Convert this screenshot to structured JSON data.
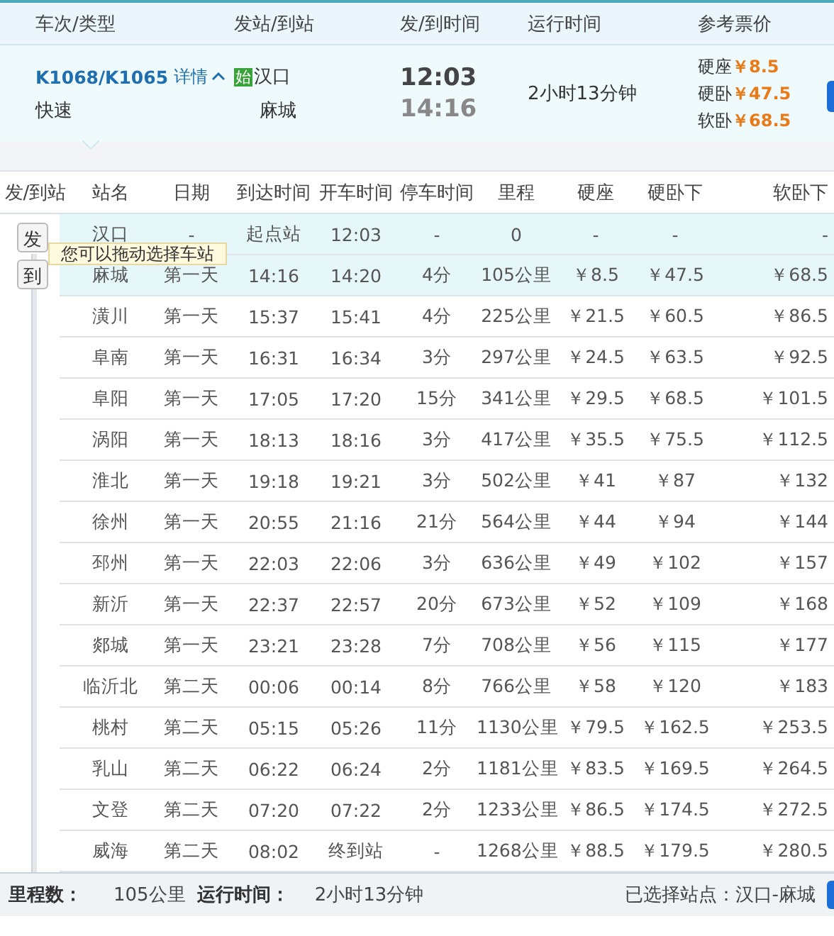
{
  "list_header": {
    "columns": [
      "车次/类型",
      "发站/到站",
      "发/到时间",
      "运行时间",
      "参考票价"
    ]
  },
  "train": {
    "number": "K1068/K1065",
    "details_link": "详情",
    "expanded": true,
    "type": "快速",
    "origin_badge": "始",
    "from": "汉口",
    "to": "麻城",
    "depart": "12:03",
    "arrive": "14:16",
    "duration": "2小时13分钟",
    "prices": [
      {
        "seat": "硬座",
        "price": "￥8.5"
      },
      {
        "seat": "硬卧",
        "price": "￥47.5"
      },
      {
        "seat": "软卧",
        "price": "￥68.5"
      }
    ]
  },
  "stops": {
    "columns": [
      "发/到站",
      "站名",
      "日期",
      "到达时间",
      "开车时间",
      "停车时间",
      "里程",
      "硬座",
      "硬卧下",
      "软卧下"
    ],
    "handles": {
      "start": "发",
      "end": "到"
    },
    "tooltip": "您可以拖动选择车站",
    "rows": [
      {
        "selected": true,
        "cells": [
          "",
          "汉口",
          "-",
          "起点站",
          "12:03",
          "-",
          "0",
          "-",
          "-",
          "-"
        ]
      },
      {
        "selected": true,
        "cells": [
          "",
          "麻城",
          "第一天",
          "14:16",
          "14:20",
          "4分",
          "105公里",
          "￥8.5",
          "￥47.5",
          "￥68.5"
        ]
      },
      {
        "selected": false,
        "cells": [
          "",
          "潢川",
          "第一天",
          "15:37",
          "15:41",
          "4分",
          "225公里",
          "￥21.5",
          "￥60.5",
          "￥86.5"
        ]
      },
      {
        "selected": false,
        "cells": [
          "",
          "阜南",
          "第一天",
          "16:31",
          "16:34",
          "3分",
          "297公里",
          "￥24.5",
          "￥63.5",
          "￥92.5"
        ]
      },
      {
        "selected": false,
        "cells": [
          "",
          "阜阳",
          "第一天",
          "17:05",
          "17:20",
          "15分",
          "341公里",
          "￥29.5",
          "￥68.5",
          "￥101.5"
        ]
      },
      {
        "selected": false,
        "cells": [
          "",
          "涡阳",
          "第一天",
          "18:13",
          "18:16",
          "3分",
          "417公里",
          "￥35.5",
          "￥75.5",
          "￥112.5"
        ]
      },
      {
        "selected": false,
        "cells": [
          "",
          "淮北",
          "第一天",
          "19:18",
          "19:21",
          "3分",
          "502公里",
          "￥41",
          "￥87",
          "￥132"
        ]
      },
      {
        "selected": false,
        "cells": [
          "",
          "徐州",
          "第一天",
          "20:55",
          "21:16",
          "21分",
          "564公里",
          "￥44",
          "￥94",
          "￥144"
        ]
      },
      {
        "selected": false,
        "cells": [
          "",
          "邳州",
          "第一天",
          "22:03",
          "22:06",
          "3分",
          "636公里",
          "￥49",
          "￥102",
          "￥157"
        ]
      },
      {
        "selected": false,
        "cells": [
          "",
          "新沂",
          "第一天",
          "22:37",
          "22:57",
          "20分",
          "673公里",
          "￥52",
          "￥109",
          "￥168"
        ]
      },
      {
        "selected": false,
        "cells": [
          "",
          "郯城",
          "第一天",
          "23:21",
          "23:28",
          "7分",
          "708公里",
          "￥56",
          "￥115",
          "￥177"
        ]
      },
      {
        "selected": false,
        "cells": [
          "",
          "临沂北",
          "第二天",
          "00:06",
          "00:14",
          "8分",
          "766公里",
          "￥58",
          "￥120",
          "￥183"
        ]
      },
      {
        "selected": false,
        "cells": [
          "",
          "桃村",
          "第二天",
          "05:15",
          "05:26",
          "11分",
          "1130公里",
          "￥79.5",
          "￥162.5",
          "￥253.5"
        ]
      },
      {
        "selected": false,
        "cells": [
          "",
          "乳山",
          "第二天",
          "06:22",
          "06:24",
          "2分",
          "1181公里",
          "￥83.5",
          "￥169.5",
          "￥264.5"
        ]
      },
      {
        "selected": false,
        "cells": [
          "",
          "文登",
          "第二天",
          "07:20",
          "07:22",
          "2分",
          "1233公里",
          "￥86.5",
          "￥174.5",
          "￥272.5"
        ]
      },
      {
        "selected": false,
        "cells": [
          "",
          "威海",
          "第二天",
          "08:02",
          "终到站",
          "-",
          "1268公里",
          "￥88.5",
          "￥179.5",
          "￥280.5"
        ]
      }
    ]
  },
  "footer": {
    "distance_label": "里程数：",
    "distance": "105公里",
    "time_label": "运行时间：",
    "time": "2小时13分钟",
    "selection": "已选择站点：汉口-麻城"
  }
}
